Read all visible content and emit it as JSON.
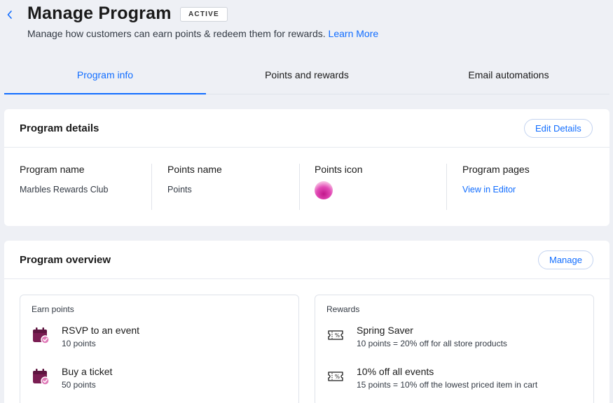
{
  "header": {
    "title": "Manage Program",
    "status": "ACTIVE",
    "subtitle": "Manage how customers can earn points & redeem them for rewards.",
    "learn_more": "Learn More"
  },
  "tabs": [
    {
      "label": "Program info",
      "active": true
    },
    {
      "label": "Points and rewards",
      "active": false
    },
    {
      "label": "Email automations",
      "active": false
    }
  ],
  "program_details": {
    "title": "Program details",
    "edit_label": "Edit Details",
    "columns": {
      "program_name": {
        "label": "Program name",
        "value": "Marbles Rewards Club"
      },
      "points_name": {
        "label": "Points name",
        "value": "Points"
      },
      "points_icon": {
        "label": "Points icon",
        "icon": "marble-icon"
      },
      "program_pages": {
        "label": "Program pages",
        "link": "View in Editor"
      }
    }
  },
  "program_overview": {
    "title": "Program overview",
    "manage_label": "Manage",
    "earn": {
      "label": "Earn points",
      "items": [
        {
          "title": "RSVP to an event",
          "desc": "10 points",
          "icon": "calendar-check-icon"
        },
        {
          "title": "Buy a ticket",
          "desc": "50 points",
          "icon": "calendar-check-icon"
        }
      ]
    },
    "rewards": {
      "label": "Rewards",
      "items": [
        {
          "title": "Spring Saver",
          "desc": "10 points = 20% off for all store products",
          "icon": "coupon-icon"
        },
        {
          "title": "10% off all events",
          "desc": "15 points = 10% off the lowest priced item in cart",
          "icon": "coupon-icon"
        }
      ]
    }
  },
  "colors": {
    "accent": "#116dff",
    "background": "#eef0f5",
    "calendar_icon": "#7a1d52"
  }
}
